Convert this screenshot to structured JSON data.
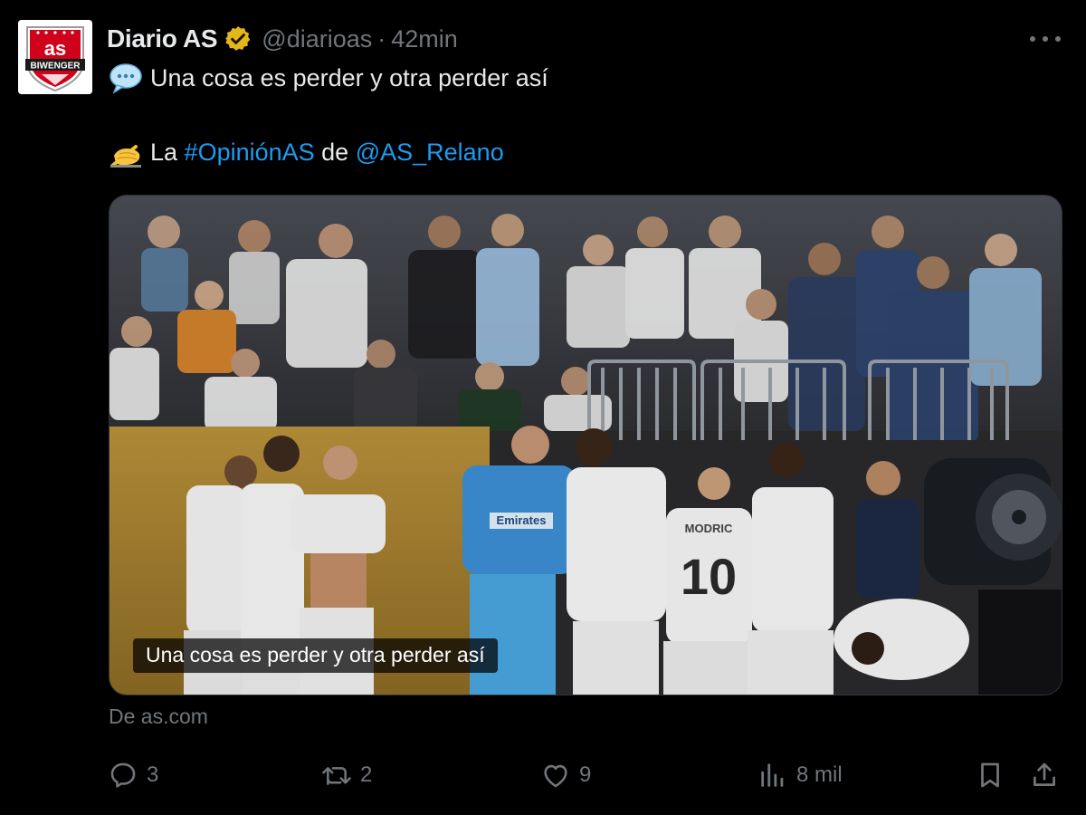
{
  "tweet": {
    "author": {
      "display_name": "Diario AS",
      "handle": "@diarioas",
      "verified": true,
      "avatar_text_top": "as",
      "avatar_text_bottom": "BIWENGER"
    },
    "separator": "·",
    "time": "42min",
    "text": {
      "line1_emoji": "speech-balloon-icon",
      "line1": "Una cosa es perder y otra perder así",
      "line2_emoji": "writing-hand-icon",
      "line2_prefix": "La ",
      "hashtag": "#OpiniónAS",
      "line2_middle": " de ",
      "mention": "@AS_Relano"
    },
    "media": {
      "caption": "Una cosa es perder y otra perder así",
      "jersey_number": "10",
      "jersey_name": "MODRIC",
      "sponsor": "Emirates"
    },
    "source": "De as.com",
    "actions": {
      "replies": "3",
      "reposts": "2",
      "likes": "9",
      "views": "8 mil"
    }
  },
  "colors": {
    "background": "#000000",
    "text_primary": "#e7e9ea",
    "text_secondary": "#71767b",
    "link": "#1d9bf0",
    "verified_badge": "#e2b719",
    "avatar_red": "#d0021b"
  }
}
